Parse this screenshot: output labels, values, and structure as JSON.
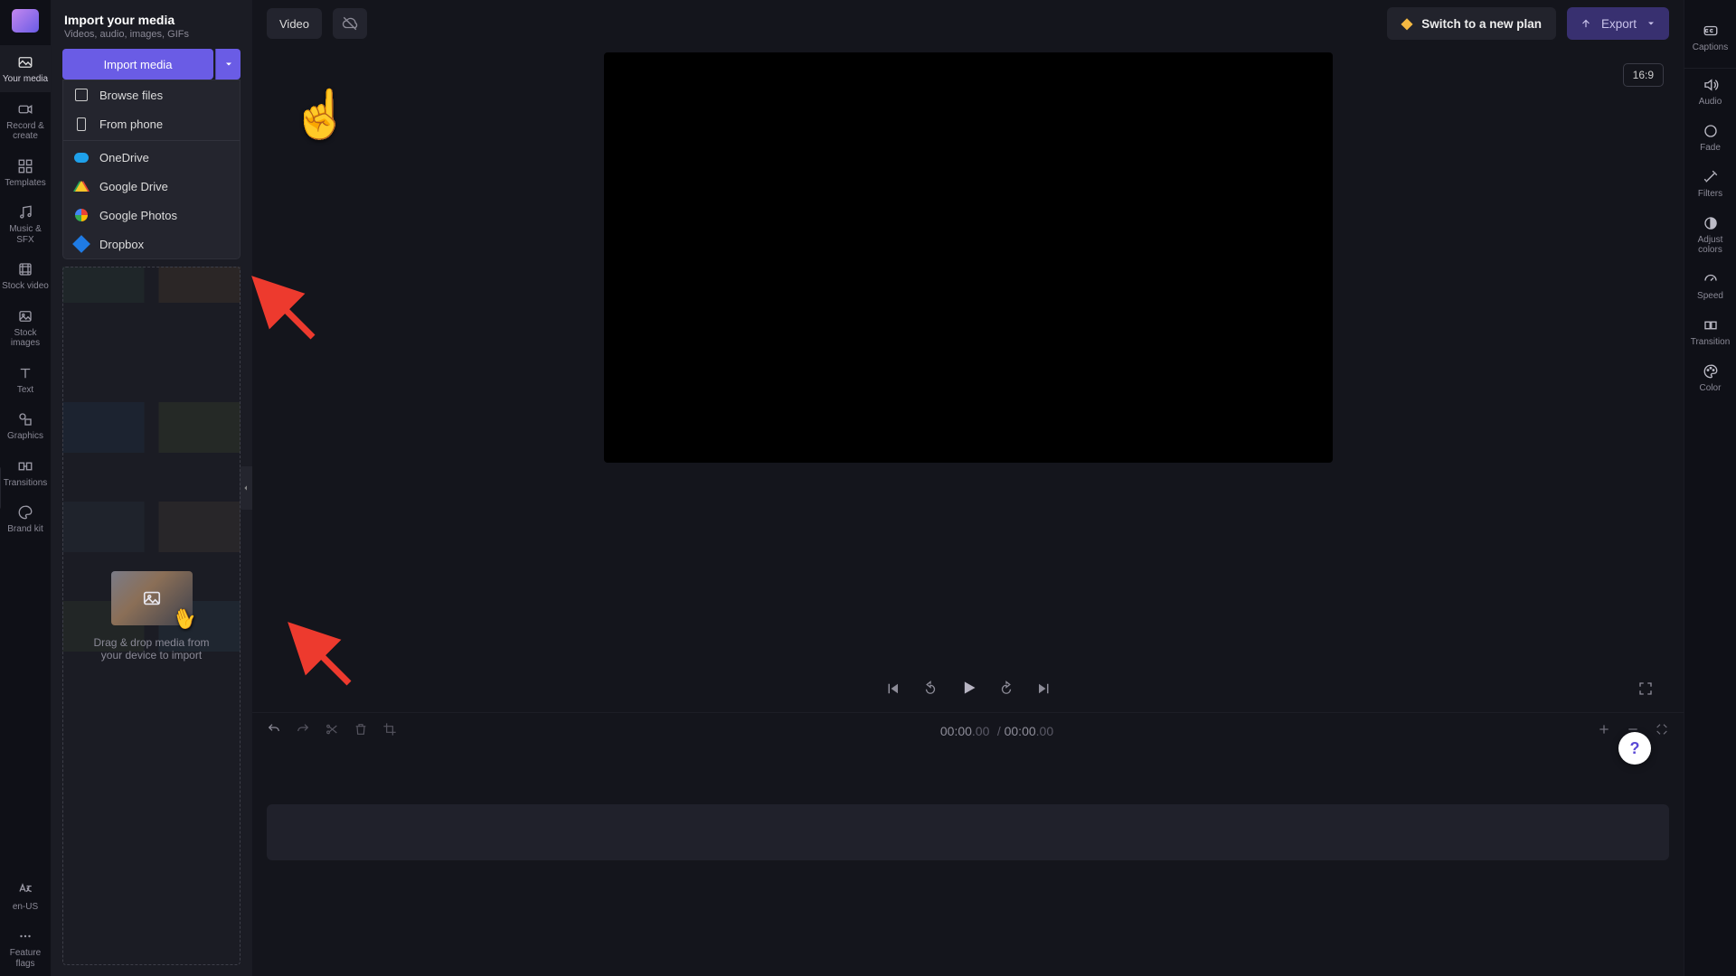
{
  "leftnav": {
    "items": [
      {
        "id": "your-media",
        "label": "Your media",
        "icon": "image"
      },
      {
        "id": "record",
        "label": "Record &\ncreate",
        "icon": "camcorder"
      },
      {
        "id": "templates",
        "label": "Templates",
        "icon": "grid"
      },
      {
        "id": "music",
        "label": "Music & SFX",
        "icon": "music"
      },
      {
        "id": "stock-video",
        "label": "Stock video",
        "icon": "film"
      },
      {
        "id": "stock-images",
        "label": "Stock\nimages",
        "icon": "picture"
      },
      {
        "id": "text",
        "label": "Text",
        "icon": "text"
      },
      {
        "id": "graphics",
        "label": "Graphics",
        "icon": "shapes"
      },
      {
        "id": "transitions",
        "label": "Transitions",
        "icon": "transition"
      },
      {
        "id": "brand",
        "label": "Brand kit",
        "icon": "palette"
      }
    ],
    "locale": "en-US",
    "feature_flags_label": "Feature\nflags"
  },
  "media_panel": {
    "title": "Import your media",
    "subtitle": "Videos, audio, images, GIFs",
    "import_button": "Import media",
    "dropdown": {
      "browse": "Browse files",
      "phone": "From phone",
      "onedrive": "OneDrive",
      "gdrive": "Google Drive",
      "gphotos": "Google Photos",
      "dropbox": "Dropbox"
    },
    "drop_hint": "Drag & drop media from\nyour device to import"
  },
  "topbar": {
    "video_title_placeholder": "Video",
    "switch_plan": "Switch to a new plan",
    "export": "Export"
  },
  "preview": {
    "aspect": "16:9"
  },
  "timeline": {
    "current": "00:00",
    "current_ms": ".00",
    "total": "00:00",
    "total_ms": ".00"
  },
  "rightnav": {
    "tools": [
      {
        "id": "captions",
        "label": "Captions",
        "icon": "cc"
      },
      {
        "id": "audio",
        "label": "Audio",
        "icon": "speaker"
      },
      {
        "id": "fade",
        "label": "Fade",
        "icon": "circle"
      },
      {
        "id": "filters",
        "label": "Filters",
        "icon": "wand"
      },
      {
        "id": "adjust",
        "label": "Adjust\ncolors",
        "icon": "contrast"
      },
      {
        "id": "speed",
        "label": "Speed",
        "icon": "gauge"
      },
      {
        "id": "transition",
        "label": "Transition",
        "icon": "square"
      },
      {
        "id": "color",
        "label": "Color",
        "icon": "palette2"
      }
    ]
  },
  "help_label": "?"
}
